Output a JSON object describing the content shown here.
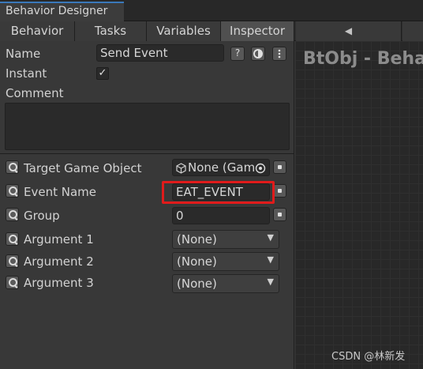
{
  "window": {
    "title": "Behavior Designer"
  },
  "tabs": [
    {
      "label": "Behavior"
    },
    {
      "label": "Tasks"
    },
    {
      "label": "Variables"
    },
    {
      "label": "Inspector"
    }
  ],
  "nav": {
    "back_glyph": "◀"
  },
  "inspector": {
    "name_label": "Name",
    "name_value": "Send Event",
    "help_glyph": "?",
    "instant_label": "Instant",
    "instant_checked": "✓",
    "comment_label": "Comment",
    "comment_value": "",
    "fields": {
      "target": {
        "label": "Target Game Object",
        "value": "None (Gam"
      },
      "event_name": {
        "label": "Event Name",
        "value": "EAT_EVENT"
      },
      "group": {
        "label": "Group",
        "value": "0"
      },
      "arg1": {
        "label": "Argument 1",
        "value": "(None)"
      },
      "arg2": {
        "label": "Argument 2",
        "value": "(None)"
      },
      "arg3": {
        "label": "Argument 3",
        "value": "(None)"
      }
    }
  },
  "graph": {
    "title": "BtObj - Beha"
  },
  "watermark": "CSDN @林新发",
  "colors": {
    "highlight": "#e01b1b",
    "accent": "#3a79bb"
  },
  "icons": [
    "help-icon",
    "preset-icon",
    "gear-icon",
    "search-icon",
    "dot-button-icon",
    "gameobject-icon",
    "target-picker-icon",
    "dropdown-arrow-icon",
    "back-arrow-icon"
  ]
}
